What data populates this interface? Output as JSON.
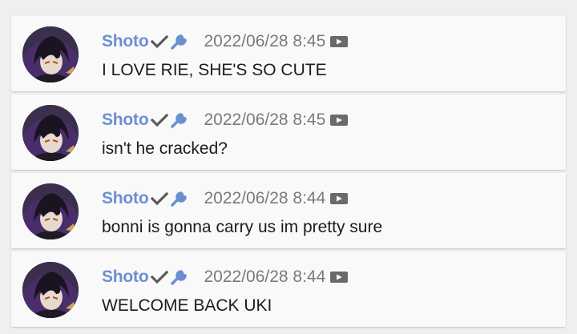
{
  "comments": [
    {
      "author": "Shoto",
      "timestamp": "2022/06/28 8:45",
      "message": "I LOVE RIE, SHE'S SO CUTE",
      "badges": [
        "check-icon",
        "wrench-icon"
      ],
      "media_icon": "video-icon"
    },
    {
      "author": "Shoto",
      "timestamp": "2022/06/28 8:45",
      "message": "isn't he cracked?",
      "badges": [
        "check-icon",
        "wrench-icon"
      ],
      "media_icon": "video-icon"
    },
    {
      "author": "Shoto",
      "timestamp": "2022/06/28 8:44",
      "message": "bonni is gonna carry us im pretty sure",
      "badges": [
        "check-icon",
        "wrench-icon"
      ],
      "media_icon": "video-icon"
    },
    {
      "author": "Shoto",
      "timestamp": "2022/06/28 8:44",
      "message": "WELCOME BACK UKI",
      "badges": [
        "check-icon",
        "wrench-icon"
      ],
      "media_icon": "video-icon"
    }
  ],
  "colors": {
    "author": "#6b8fd1",
    "timestamp": "#7a7a7a",
    "message": "#1c1c1c",
    "card_background": "#f9f9f9",
    "page_background": "#efefef",
    "check_icon": "#5a5a5a",
    "wrench_icon": "#6b8fd1",
    "video_icon": "#6a6a6a"
  }
}
